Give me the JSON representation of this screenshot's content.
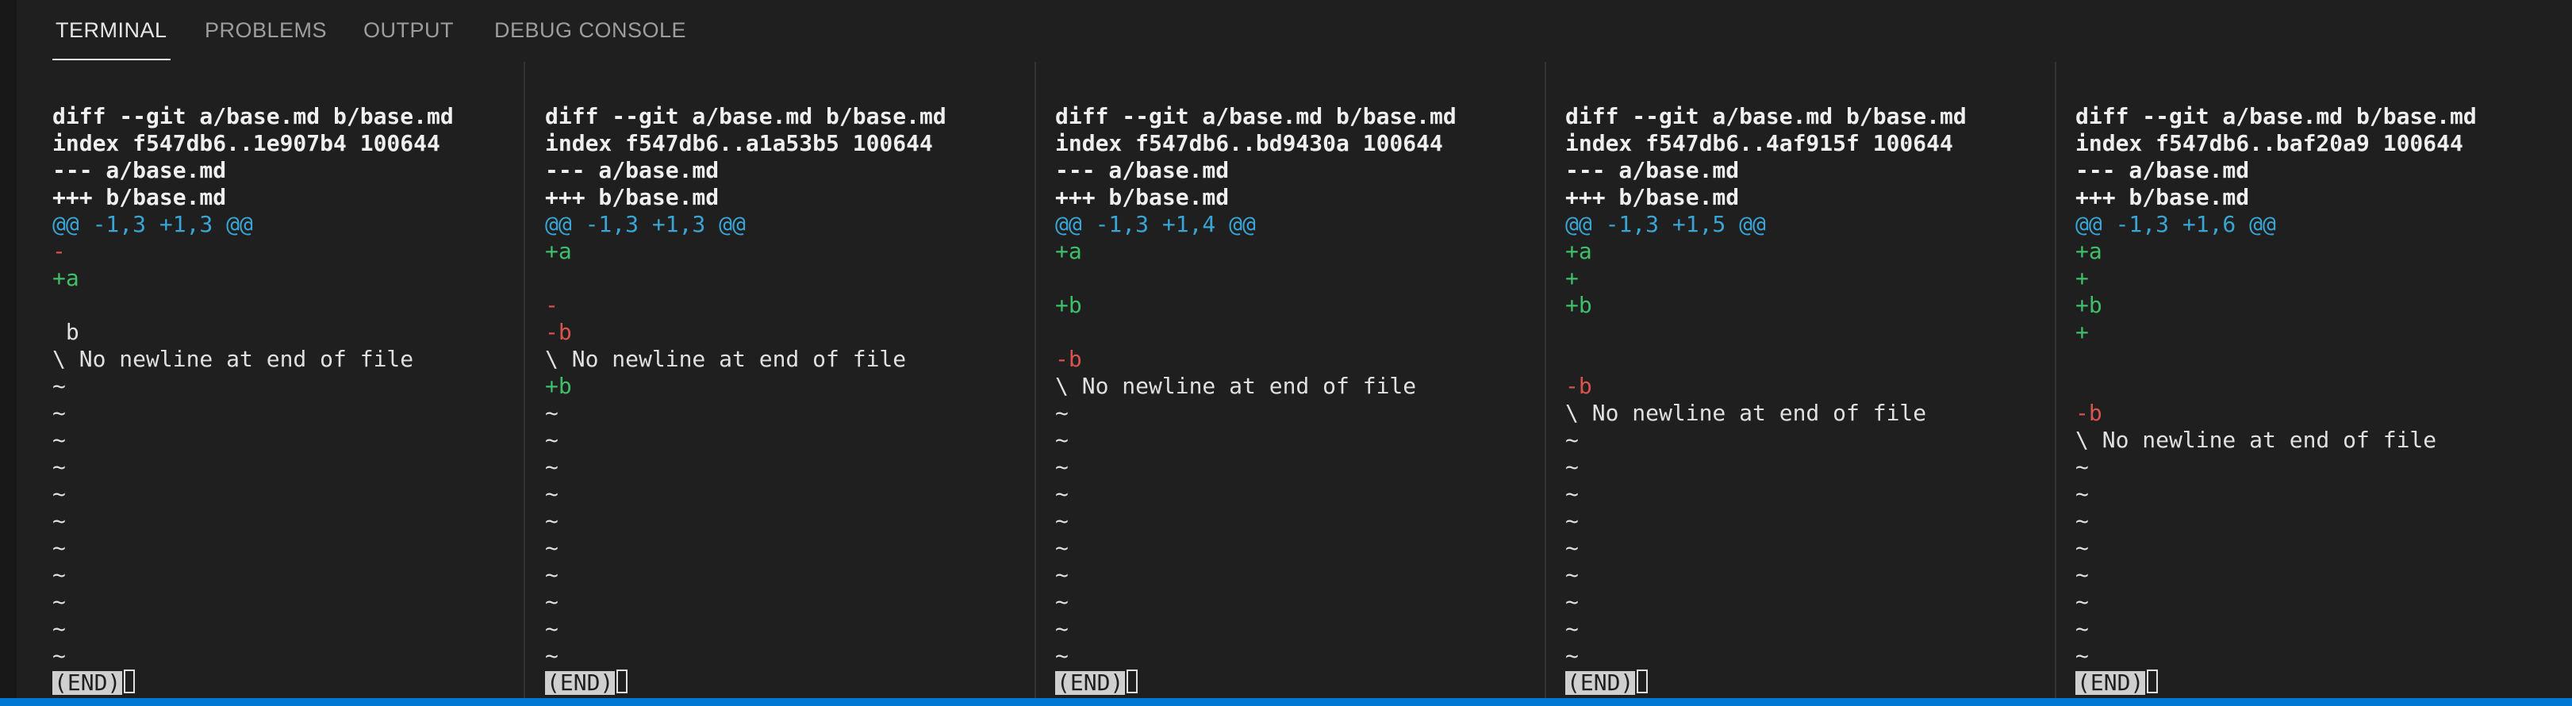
{
  "tabs": [
    {
      "label": "TERMINAL",
      "active": true
    },
    {
      "label": "PROBLEMS",
      "active": false
    },
    {
      "label": "OUTPUT",
      "active": false
    },
    {
      "label": "DEBUG CONSOLE",
      "active": false
    }
  ],
  "panes": [
    {
      "lines": [
        {
          "text": "diff --git a/base.md b/base.md",
          "style": "bold"
        },
        {
          "text": "index f547db6..1e907b4 100644",
          "style": "bold"
        },
        {
          "text": "--- a/base.md",
          "style": "bold"
        },
        {
          "text": "+++ b/base.md",
          "style": "bold"
        },
        {
          "text": "@@ -1,3 +1,3 @@",
          "style": "hunk"
        },
        {
          "text": "-",
          "style": "del"
        },
        {
          "text": "+a",
          "style": "add"
        },
        {
          "text": "",
          "style": "plain"
        },
        {
          "text": " b",
          "style": "plain"
        },
        {
          "text": "\\ No newline at end of file",
          "style": "plain"
        },
        {
          "text": "~",
          "style": "tilde"
        },
        {
          "text": "~",
          "style": "tilde"
        },
        {
          "text": "~",
          "style": "tilde"
        },
        {
          "text": "~",
          "style": "tilde"
        },
        {
          "text": "~",
          "style": "tilde"
        },
        {
          "text": "~",
          "style": "tilde"
        },
        {
          "text": "~",
          "style": "tilde"
        },
        {
          "text": "~",
          "style": "tilde"
        },
        {
          "text": "~",
          "style": "tilde"
        },
        {
          "text": "~",
          "style": "tilde"
        },
        {
          "text": "~",
          "style": "tilde"
        }
      ],
      "end_label": "(END)"
    },
    {
      "lines": [
        {
          "text": "diff --git a/base.md b/base.md",
          "style": "bold"
        },
        {
          "text": "index f547db6..a1a53b5 100644",
          "style": "bold"
        },
        {
          "text": "--- a/base.md",
          "style": "bold"
        },
        {
          "text": "+++ b/base.md",
          "style": "bold"
        },
        {
          "text": "@@ -1,3 +1,3 @@",
          "style": "hunk"
        },
        {
          "text": "+a",
          "style": "add"
        },
        {
          "text": "",
          "style": "plain"
        },
        {
          "text": "-",
          "style": "del"
        },
        {
          "text": "-b",
          "style": "del"
        },
        {
          "text": "\\ No newline at end of file",
          "style": "plain"
        },
        {
          "text": "+b",
          "style": "add"
        },
        {
          "text": "~",
          "style": "tilde"
        },
        {
          "text": "~",
          "style": "tilde"
        },
        {
          "text": "~",
          "style": "tilde"
        },
        {
          "text": "~",
          "style": "tilde"
        },
        {
          "text": "~",
          "style": "tilde"
        },
        {
          "text": "~",
          "style": "tilde"
        },
        {
          "text": "~",
          "style": "tilde"
        },
        {
          "text": "~",
          "style": "tilde"
        },
        {
          "text": "~",
          "style": "tilde"
        },
        {
          "text": "~",
          "style": "tilde"
        }
      ],
      "end_label": "(END)"
    },
    {
      "lines": [
        {
          "text": "diff --git a/base.md b/base.md",
          "style": "bold"
        },
        {
          "text": "index f547db6..bd9430a 100644",
          "style": "bold"
        },
        {
          "text": "--- a/base.md",
          "style": "bold"
        },
        {
          "text": "+++ b/base.md",
          "style": "bold"
        },
        {
          "text": "@@ -1,3 +1,4 @@",
          "style": "hunk"
        },
        {
          "text": "+a",
          "style": "add"
        },
        {
          "text": "",
          "style": "plain"
        },
        {
          "text": "+b",
          "style": "add"
        },
        {
          "text": "",
          "style": "plain"
        },
        {
          "text": "-b",
          "style": "del"
        },
        {
          "text": "\\ No newline at end of file",
          "style": "plain"
        },
        {
          "text": "~",
          "style": "tilde"
        },
        {
          "text": "~",
          "style": "tilde"
        },
        {
          "text": "~",
          "style": "tilde"
        },
        {
          "text": "~",
          "style": "tilde"
        },
        {
          "text": "~",
          "style": "tilde"
        },
        {
          "text": "~",
          "style": "tilde"
        },
        {
          "text": "~",
          "style": "tilde"
        },
        {
          "text": "~",
          "style": "tilde"
        },
        {
          "text": "~",
          "style": "tilde"
        },
        {
          "text": "~",
          "style": "tilde"
        }
      ],
      "end_label": "(END)"
    },
    {
      "lines": [
        {
          "text": "diff --git a/base.md b/base.md",
          "style": "bold"
        },
        {
          "text": "index f547db6..4af915f 100644",
          "style": "bold"
        },
        {
          "text": "--- a/base.md",
          "style": "bold"
        },
        {
          "text": "+++ b/base.md",
          "style": "bold"
        },
        {
          "text": "@@ -1,3 +1,5 @@",
          "style": "hunk"
        },
        {
          "text": "+a",
          "style": "add"
        },
        {
          "text": "+",
          "style": "add"
        },
        {
          "text": "+b",
          "style": "add"
        },
        {
          "text": "",
          "style": "plain"
        },
        {
          "text": "",
          "style": "plain"
        },
        {
          "text": "-b",
          "style": "del"
        },
        {
          "text": "\\ No newline at end of file",
          "style": "plain"
        },
        {
          "text": "~",
          "style": "tilde"
        },
        {
          "text": "~",
          "style": "tilde"
        },
        {
          "text": "~",
          "style": "tilde"
        },
        {
          "text": "~",
          "style": "tilde"
        },
        {
          "text": "~",
          "style": "tilde"
        },
        {
          "text": "~",
          "style": "tilde"
        },
        {
          "text": "~",
          "style": "tilde"
        },
        {
          "text": "~",
          "style": "tilde"
        },
        {
          "text": "~",
          "style": "tilde"
        }
      ],
      "end_label": "(END)"
    },
    {
      "lines": [
        {
          "text": "diff --git a/base.md b/base.md",
          "style": "bold"
        },
        {
          "text": "index f547db6..baf20a9 100644",
          "style": "bold"
        },
        {
          "text": "--- a/base.md",
          "style": "bold"
        },
        {
          "text": "+++ b/base.md",
          "style": "bold"
        },
        {
          "text": "@@ -1,3 +1,6 @@",
          "style": "hunk"
        },
        {
          "text": "+a",
          "style": "add"
        },
        {
          "text": "+",
          "style": "add"
        },
        {
          "text": "+b",
          "style": "add"
        },
        {
          "text": "+",
          "style": "add"
        },
        {
          "text": "",
          "style": "plain"
        },
        {
          "text": "",
          "style": "plain"
        },
        {
          "text": "-b",
          "style": "del"
        },
        {
          "text": "\\ No newline at end of file",
          "style": "plain"
        },
        {
          "text": "~",
          "style": "tilde"
        },
        {
          "text": "~",
          "style": "tilde"
        },
        {
          "text": "~",
          "style": "tilde"
        },
        {
          "text": "~",
          "style": "tilde"
        },
        {
          "text": "~",
          "style": "tilde"
        },
        {
          "text": "~",
          "style": "tilde"
        },
        {
          "text": "~",
          "style": "tilde"
        },
        {
          "text": "~",
          "style": "tilde"
        }
      ],
      "end_label": "(END)"
    }
  ],
  "colors": {
    "background": "#1f1f1f",
    "hunk": "#3aa5d4",
    "added": "#3fbf6a",
    "removed": "#d9534f",
    "accent": "#0078d4"
  }
}
